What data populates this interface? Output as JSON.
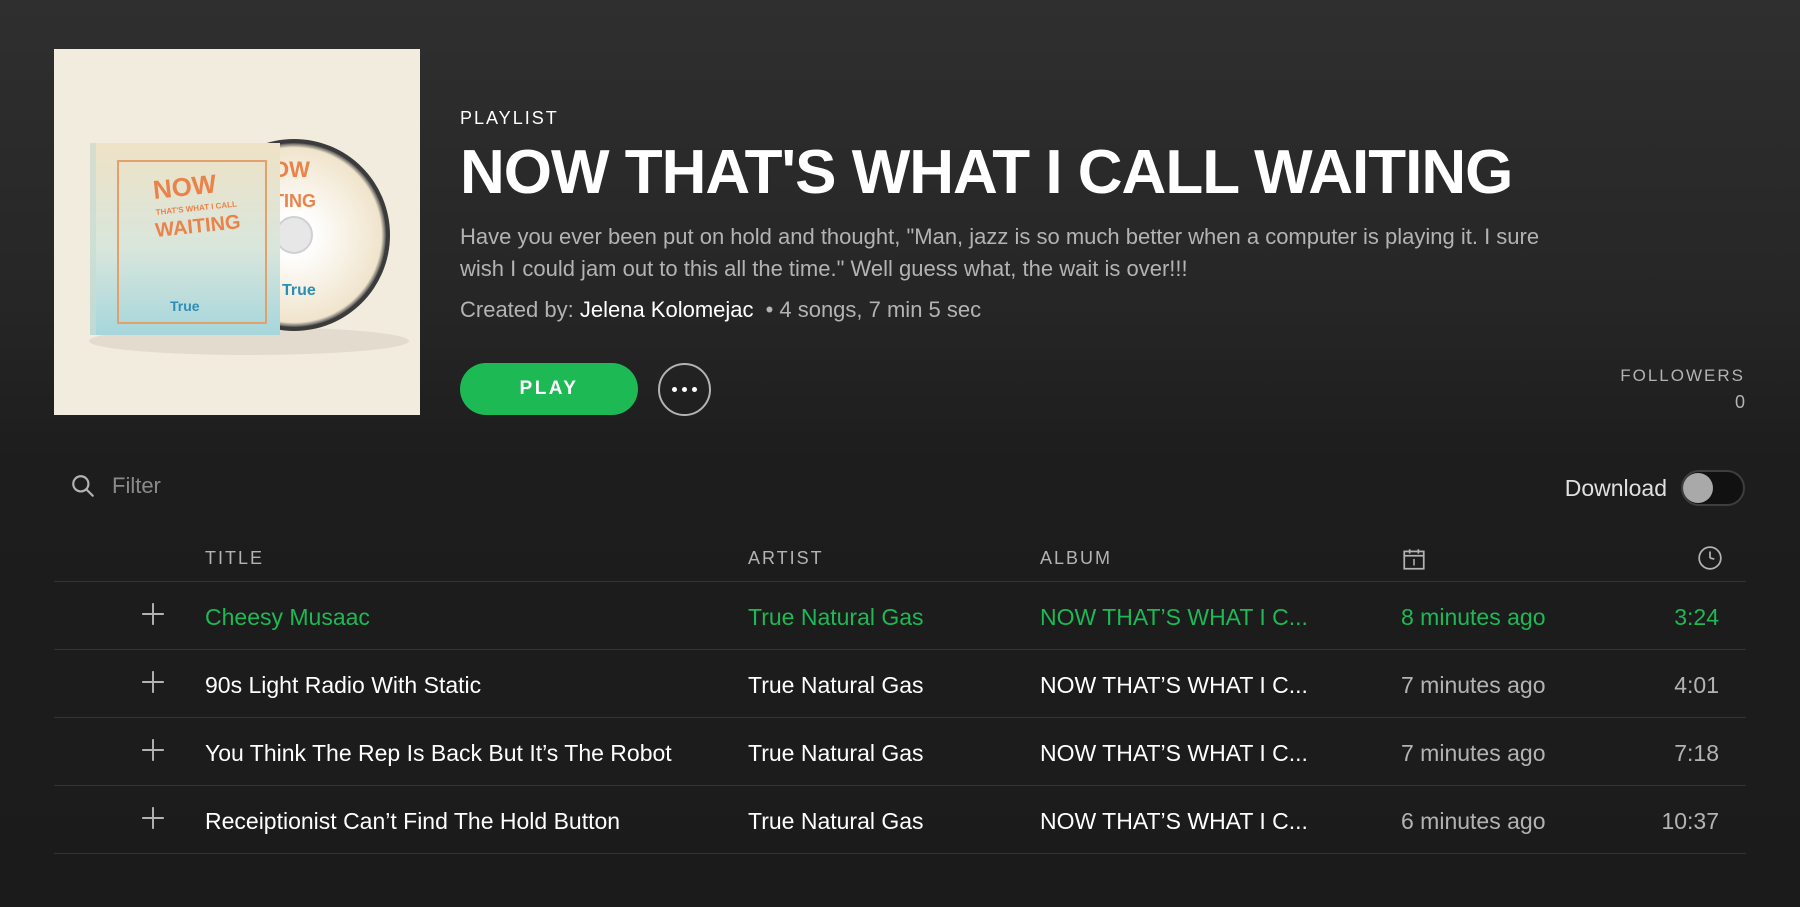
{
  "playlist": {
    "type_label": "PLAYLIST",
    "title": "NOW THAT'S WHAT I CALL WAITING",
    "description": "Have you ever been put on hold and thought, \"Man, jazz is so much better when a computer is playing it. I sure wish I could jam out to this all the time.\" Well guess what, the wait is over!!!",
    "created_by_label": "Created by:",
    "owner": "Jelena Kolomejac",
    "dot": "•",
    "summary": "4 songs, 7 min 5 sec",
    "cover_text": {
      "line1": "NOW",
      "line2": "THAT'S WHAT I CALL",
      "line3": "WAITING",
      "brand": "True"
    }
  },
  "actions": {
    "play_label": "PLAY",
    "more_icon": "ellipsis-icon"
  },
  "followers": {
    "label": "FOLLOWERS",
    "count": "0"
  },
  "filter": {
    "placeholder": "Filter",
    "icon": "search-icon"
  },
  "download": {
    "label": "Download",
    "enabled": false
  },
  "table": {
    "headers": {
      "title": "TITLE",
      "artist": "ARTIST",
      "album": "ALBUM",
      "date_icon": "calendar-icon",
      "duration_icon": "clock-icon"
    },
    "rows": [
      {
        "title": "Cheesy Musaac",
        "artist": "True Natural Gas",
        "album": "NOW THAT’S WHAT I C...",
        "added": "8 minutes ago",
        "duration": "3:24",
        "playing": true
      },
      {
        "title": "90s Light Radio With Static",
        "artist": "True Natural Gas",
        "album": "NOW THAT’S WHAT I C...",
        "added": "7 minutes ago",
        "duration": "4:01",
        "playing": false
      },
      {
        "title": "You Think The Rep Is Back But It’s The Robot",
        "artist": "True Natural Gas",
        "album": "NOW THAT’S WHAT I C...",
        "added": "7 minutes ago",
        "duration": "7:18",
        "playing": false
      },
      {
        "title": "Receiptionist Can’t Find The Hold Button",
        "artist": "True Natural Gas",
        "album": "NOW THAT’S WHAT I C...",
        "added": "6 minutes ago",
        "duration": "10:37",
        "playing": false
      }
    ]
  },
  "colors": {
    "accent": "#1db954",
    "background": "#1b1b1b",
    "muted_text": "#b3b3b3"
  }
}
